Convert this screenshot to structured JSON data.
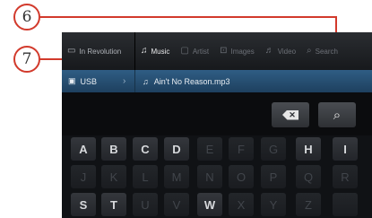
{
  "callouts": [
    {
      "number": "6"
    },
    {
      "number": "7"
    }
  ],
  "tabs": {
    "source": {
      "label": "In Revolution",
      "icon": "device-icon"
    },
    "items": [
      {
        "label": "Music",
        "icon": "music-note-icon",
        "active": true
      },
      {
        "label": "Artist",
        "icon": "artist-icon",
        "active": false
      },
      {
        "label": "Images",
        "icon": "image-icon",
        "active": false
      },
      {
        "label": "Video",
        "icon": "video-icon",
        "active": false
      },
      {
        "label": "Search",
        "icon": "search-icon",
        "active": false
      }
    ]
  },
  "path": {
    "source": "USB",
    "source_icon": "usb-drive-icon",
    "file": "Ain't No Reason.mp3",
    "file_icon": "music-note-icon"
  },
  "input": {
    "backspace_icon": "backspace-icon",
    "search_icon": "search-icon"
  },
  "keyboard": {
    "rows": [
      [
        {
          "k": "A",
          "enabled": true
        },
        {
          "k": "B",
          "enabled": true
        },
        {
          "k": "C",
          "enabled": true
        },
        {
          "k": "D",
          "enabled": true
        },
        {
          "k": "E",
          "enabled": false
        },
        {
          "k": "F",
          "enabled": false
        },
        {
          "k": "G",
          "enabled": false
        },
        {
          "k": "H",
          "enabled": true
        },
        {
          "k": "I",
          "enabled": true
        }
      ],
      [
        {
          "k": "J",
          "enabled": false
        },
        {
          "k": "K",
          "enabled": false
        },
        {
          "k": "L",
          "enabled": false
        },
        {
          "k": "M",
          "enabled": false
        },
        {
          "k": "N",
          "enabled": false
        },
        {
          "k": "O",
          "enabled": false
        },
        {
          "k": "P",
          "enabled": false
        },
        {
          "k": "Q",
          "enabled": false
        },
        {
          "k": "R",
          "enabled": false
        }
      ],
      [
        {
          "k": "S",
          "enabled": true
        },
        {
          "k": "T",
          "enabled": true
        },
        {
          "k": "U",
          "enabled": false
        },
        {
          "k": "V",
          "enabled": false
        },
        {
          "k": "W",
          "enabled": true
        },
        {
          "k": "X",
          "enabled": false
        },
        {
          "k": "Y",
          "enabled": false
        },
        {
          "k": "Z",
          "enabled": false
        },
        {
          "k": "",
          "enabled": false
        }
      ]
    ]
  },
  "colors": {
    "callout": "#d23a2c",
    "path_bar": "#2f5d84",
    "screen_bg": "#0d0f12"
  }
}
